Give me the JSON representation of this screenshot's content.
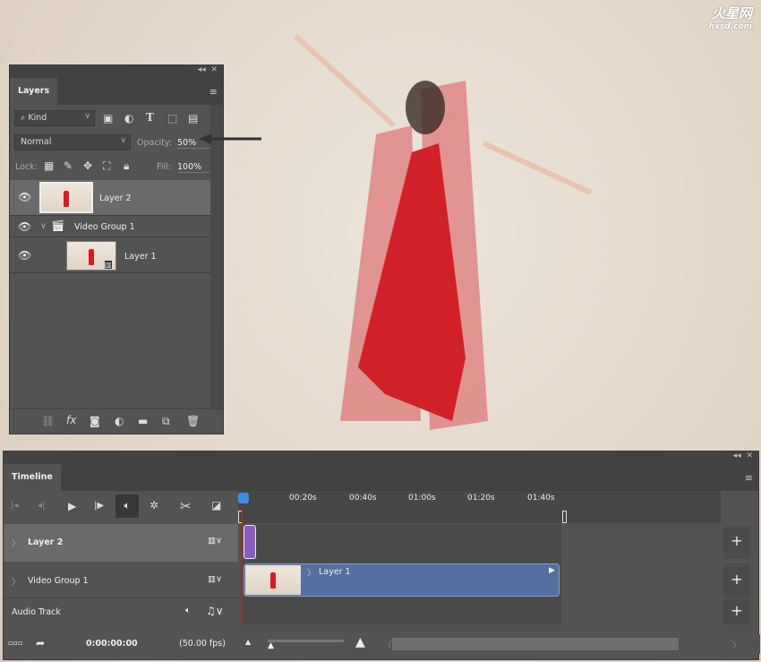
{
  "watermark": "hxsd.com",
  "layers_panel": {
    "tab": "Layers",
    "filter_kind": "Kind",
    "blend_mode": "Normal",
    "opacity_label": "Opacity:",
    "opacity_value": "50%",
    "lock_label": "Lock:",
    "fill_label": "Fill:",
    "fill_value": "100%",
    "layers": [
      {
        "name": "Layer 2",
        "selected": true
      },
      {
        "name": "Video Group 1",
        "type": "group"
      },
      {
        "name": "Layer 1",
        "type": "video"
      }
    ],
    "filter_icons": [
      "image-icon",
      "adjustment-icon",
      "type-icon",
      "shape-icon",
      "smart-object-icon"
    ],
    "lock_icons": [
      "lock-transparent-icon",
      "lock-brush-icon",
      "lock-move-icon",
      "lock-artboard-icon",
      "lock-all-icon"
    ],
    "bottom_icons": [
      "link-icon",
      "fx-icon",
      "mask-icon",
      "adjustment-icon",
      "folder-icon",
      "new-layer-icon",
      "trash-icon"
    ]
  },
  "timeline": {
    "tab": "Timeline",
    "ruler": [
      "00:20s",
      "00:40s",
      "01:00s",
      "01:20s",
      "01:40s"
    ],
    "tracks": [
      {
        "name": "Layer 2",
        "selected": true
      },
      {
        "name": "Video Group 1",
        "clip": "Layer 1"
      },
      {
        "name": "Audio Track"
      }
    ],
    "timecode": "0:00:00:00",
    "fps": "(50.00 fps)",
    "colors": {
      "clip": "#5470a0",
      "clip_purple": "#8a5cc0",
      "playhead": "#d02020"
    }
  }
}
